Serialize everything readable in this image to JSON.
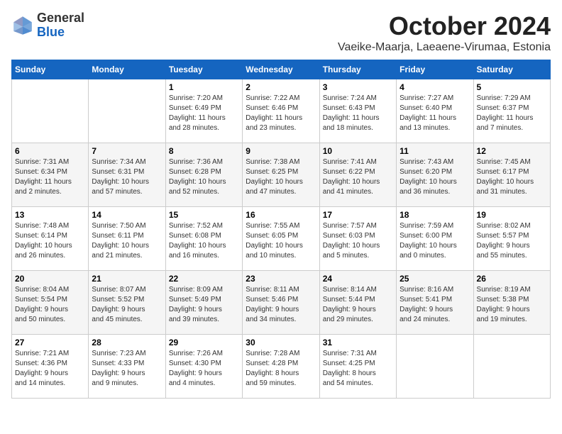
{
  "header": {
    "logo_general": "General",
    "logo_blue": "Blue",
    "month_title": "October 2024",
    "subtitle": "Vaeike-Maarja, Laeaene-Virumaa, Estonia"
  },
  "columns": [
    "Sunday",
    "Monday",
    "Tuesday",
    "Wednesday",
    "Thursday",
    "Friday",
    "Saturday"
  ],
  "weeks": [
    [
      {
        "day": "",
        "info": ""
      },
      {
        "day": "",
        "info": ""
      },
      {
        "day": "1",
        "info": "Sunrise: 7:20 AM\nSunset: 6:49 PM\nDaylight: 11 hours\nand 28 minutes."
      },
      {
        "day": "2",
        "info": "Sunrise: 7:22 AM\nSunset: 6:46 PM\nDaylight: 11 hours\nand 23 minutes."
      },
      {
        "day": "3",
        "info": "Sunrise: 7:24 AM\nSunset: 6:43 PM\nDaylight: 11 hours\nand 18 minutes."
      },
      {
        "day": "4",
        "info": "Sunrise: 7:27 AM\nSunset: 6:40 PM\nDaylight: 11 hours\nand 13 minutes."
      },
      {
        "day": "5",
        "info": "Sunrise: 7:29 AM\nSunset: 6:37 PM\nDaylight: 11 hours\nand 7 minutes."
      }
    ],
    [
      {
        "day": "6",
        "info": "Sunrise: 7:31 AM\nSunset: 6:34 PM\nDaylight: 11 hours\nand 2 minutes."
      },
      {
        "day": "7",
        "info": "Sunrise: 7:34 AM\nSunset: 6:31 PM\nDaylight: 10 hours\nand 57 minutes."
      },
      {
        "day": "8",
        "info": "Sunrise: 7:36 AM\nSunset: 6:28 PM\nDaylight: 10 hours\nand 52 minutes."
      },
      {
        "day": "9",
        "info": "Sunrise: 7:38 AM\nSunset: 6:25 PM\nDaylight: 10 hours\nand 47 minutes."
      },
      {
        "day": "10",
        "info": "Sunrise: 7:41 AM\nSunset: 6:22 PM\nDaylight: 10 hours\nand 41 minutes."
      },
      {
        "day": "11",
        "info": "Sunrise: 7:43 AM\nSunset: 6:20 PM\nDaylight: 10 hours\nand 36 minutes."
      },
      {
        "day": "12",
        "info": "Sunrise: 7:45 AM\nSunset: 6:17 PM\nDaylight: 10 hours\nand 31 minutes."
      }
    ],
    [
      {
        "day": "13",
        "info": "Sunrise: 7:48 AM\nSunset: 6:14 PM\nDaylight: 10 hours\nand 26 minutes."
      },
      {
        "day": "14",
        "info": "Sunrise: 7:50 AM\nSunset: 6:11 PM\nDaylight: 10 hours\nand 21 minutes."
      },
      {
        "day": "15",
        "info": "Sunrise: 7:52 AM\nSunset: 6:08 PM\nDaylight: 10 hours\nand 16 minutes."
      },
      {
        "day": "16",
        "info": "Sunrise: 7:55 AM\nSunset: 6:05 PM\nDaylight: 10 hours\nand 10 minutes."
      },
      {
        "day": "17",
        "info": "Sunrise: 7:57 AM\nSunset: 6:03 PM\nDaylight: 10 hours\nand 5 minutes."
      },
      {
        "day": "18",
        "info": "Sunrise: 7:59 AM\nSunset: 6:00 PM\nDaylight: 10 hours\nand 0 minutes."
      },
      {
        "day": "19",
        "info": "Sunrise: 8:02 AM\nSunset: 5:57 PM\nDaylight: 9 hours\nand 55 minutes."
      }
    ],
    [
      {
        "day": "20",
        "info": "Sunrise: 8:04 AM\nSunset: 5:54 PM\nDaylight: 9 hours\nand 50 minutes."
      },
      {
        "day": "21",
        "info": "Sunrise: 8:07 AM\nSunset: 5:52 PM\nDaylight: 9 hours\nand 45 minutes."
      },
      {
        "day": "22",
        "info": "Sunrise: 8:09 AM\nSunset: 5:49 PM\nDaylight: 9 hours\nand 39 minutes."
      },
      {
        "day": "23",
        "info": "Sunrise: 8:11 AM\nSunset: 5:46 PM\nDaylight: 9 hours\nand 34 minutes."
      },
      {
        "day": "24",
        "info": "Sunrise: 8:14 AM\nSunset: 5:44 PM\nDaylight: 9 hours\nand 29 minutes."
      },
      {
        "day": "25",
        "info": "Sunrise: 8:16 AM\nSunset: 5:41 PM\nDaylight: 9 hours\nand 24 minutes."
      },
      {
        "day": "26",
        "info": "Sunrise: 8:19 AM\nSunset: 5:38 PM\nDaylight: 9 hours\nand 19 minutes."
      }
    ],
    [
      {
        "day": "27",
        "info": "Sunrise: 7:21 AM\nSunset: 4:36 PM\nDaylight: 9 hours\nand 14 minutes."
      },
      {
        "day": "28",
        "info": "Sunrise: 7:23 AM\nSunset: 4:33 PM\nDaylight: 9 hours\nand 9 minutes."
      },
      {
        "day": "29",
        "info": "Sunrise: 7:26 AM\nSunset: 4:30 PM\nDaylight: 9 hours\nand 4 minutes."
      },
      {
        "day": "30",
        "info": "Sunrise: 7:28 AM\nSunset: 4:28 PM\nDaylight: 8 hours\nand 59 minutes."
      },
      {
        "day": "31",
        "info": "Sunrise: 7:31 AM\nSunset: 4:25 PM\nDaylight: 8 hours\nand 54 minutes."
      },
      {
        "day": "",
        "info": ""
      },
      {
        "day": "",
        "info": ""
      }
    ]
  ]
}
